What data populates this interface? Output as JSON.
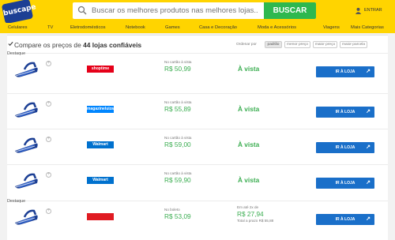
{
  "header": {
    "logo_text": "buscape",
    "search_placeholder": "Buscar os melhores produtos nas melhores lojas...",
    "search_button": "BUSCAR",
    "login_label": "ENTRAR"
  },
  "nav": [
    "Celulares",
    "TV",
    "Eletrodomésticos",
    "Notebook",
    "Games",
    "Casa e Decoração",
    "Moda e Acessórios",
    "Viagens",
    "Mais Categorias"
  ],
  "compare": {
    "title_prefix": "Compare os preços de ",
    "title_bold": "44 lojas confiáveis",
    "order_label": "Ordenar por",
    "sort_options": [
      "padrão",
      "menor preço",
      "maior preço",
      "maior parcela"
    ],
    "active_sort": "padrão"
  },
  "offers": [
    {
      "destaque": "Destaque",
      "store": "shoptime",
      "store_color": "#e50019",
      "price_label": "No cartão à vista",
      "price": "R$ 50,99",
      "payment": "À vista",
      "button": "IR À LOJA"
    },
    {
      "destaque": "",
      "store": "magazineluiza",
      "store_color": "#0086ff",
      "price_label": "No cartão à vista",
      "price": "R$ 55,89",
      "payment": "À vista",
      "button": "IR À LOJA"
    },
    {
      "destaque": "",
      "store": "Walmart",
      "store_color": "#0071ce",
      "price_label": "No cartão à vista",
      "price": "R$ 59,00",
      "payment": "À vista",
      "button": "IR À LOJA"
    },
    {
      "destaque": "",
      "store": "Walmart",
      "store_color": "#0071ce",
      "price_label": "No cartão à vista",
      "price": "R$ 59,90",
      "payment": "À vista",
      "button": "IR À LOJA"
    },
    {
      "destaque": "Destaque",
      "store": "",
      "store_color": "#e01b22",
      "price_label": "No boleto",
      "price": "R$ 53,09",
      "installments_label": "Em até 2x de",
      "installment_price": "R$ 27,94",
      "total_label": "Total a prazo R$ 55,88",
      "button": "IR À LOJA"
    }
  ],
  "colors": {
    "brand_yellow": "#ffd400",
    "price_green": "#3cae52",
    "button_blue": "#1a6fc9",
    "buy_green": "#2eb84f"
  }
}
